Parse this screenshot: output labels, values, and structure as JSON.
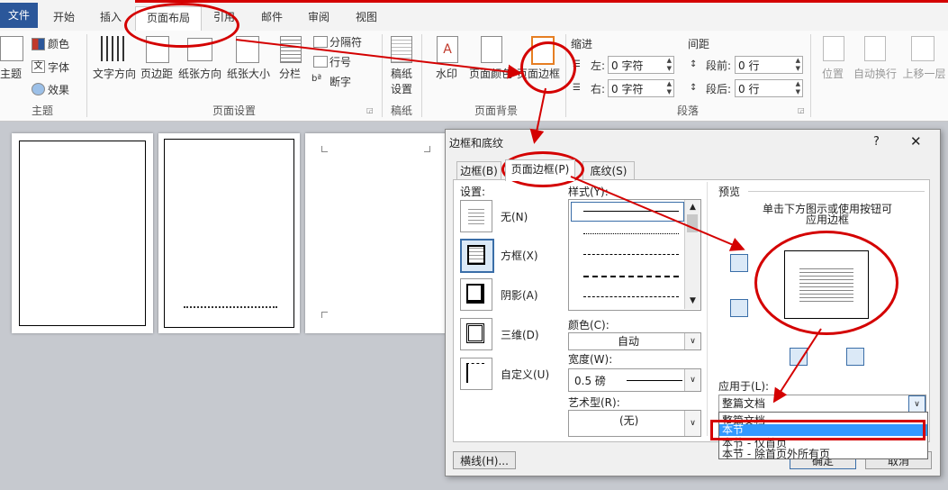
{
  "tabs": {
    "file": "文件",
    "home": "开始",
    "insert": "插入",
    "layout": "页面布局",
    "references": "引用",
    "mailings": "邮件",
    "review": "审阅",
    "view": "视图"
  },
  "ribbon": {
    "theme_group": {
      "label": "主题",
      "themes": "主题",
      "colors": "颜色",
      "fonts": "字体",
      "effects": "效果"
    },
    "page_setup_group": {
      "label": "页面设置",
      "text_direction": "文字方向",
      "margins": "页边距",
      "orientation": "纸张方向",
      "size": "纸张大小",
      "columns": "分栏",
      "breaks": "分隔符",
      "line_numbers": "行号",
      "hyphenation": "断字"
    },
    "manuscript_group": {
      "label": "稿纸",
      "settings_line1": "稿纸",
      "settings_line2": "设置"
    },
    "page_background_group": {
      "label": "页面背景",
      "watermark": "水印",
      "page_color": "页面颜色",
      "page_borders": "页面边框"
    },
    "paragraph_group": {
      "label": "段落",
      "indent": "缩进",
      "spacing": "间距",
      "left": "左:",
      "right": "右:",
      "before": "段前:",
      "after": "段后:",
      "left_value": "0 字符",
      "right_value": "0 字符",
      "before_value": "0 行",
      "after_value": "0 行"
    },
    "arrange_group": {
      "position": "位置",
      "wrap_text": "自动换行",
      "bring_forward": "上移一层"
    }
  },
  "dialog": {
    "title": "边框和底纹",
    "help": "?",
    "close": "✕",
    "tabs": {
      "borders": "边框(B)",
      "page_border": "页面边框(P)",
      "shading": "底纹(S)"
    },
    "setting_label": "设置:",
    "settings": [
      "无(N)",
      "方框(X)",
      "阴影(A)",
      "三维(D)",
      "自定义(U)"
    ],
    "style_label": "样式(Y):",
    "color_label": "颜色(C):",
    "color_value": "自动",
    "width_label": "宽度(W):",
    "width_value": "0.5 磅",
    "art_label": "艺术型(R):",
    "art_value": "(无)",
    "preview_label": "预览",
    "preview_hint_line1": "单击下方图示或使用按钮可",
    "preview_hint_line2": "应用边框",
    "apply_to_label": "应用于(L):",
    "apply_to_value": "整篇文档",
    "apply_options": [
      "整篇文档",
      "本节",
      "本节 - 仅首页",
      "本节 - 除首页外所有页"
    ],
    "horizontal_line_button": "横线(H)...",
    "ok_button": "确定",
    "cancel_button": "取消"
  },
  "colors": {
    "file_tab": "#2b579a",
    "annotation_red": "#d40000",
    "selected_option": "#3399ff"
  }
}
